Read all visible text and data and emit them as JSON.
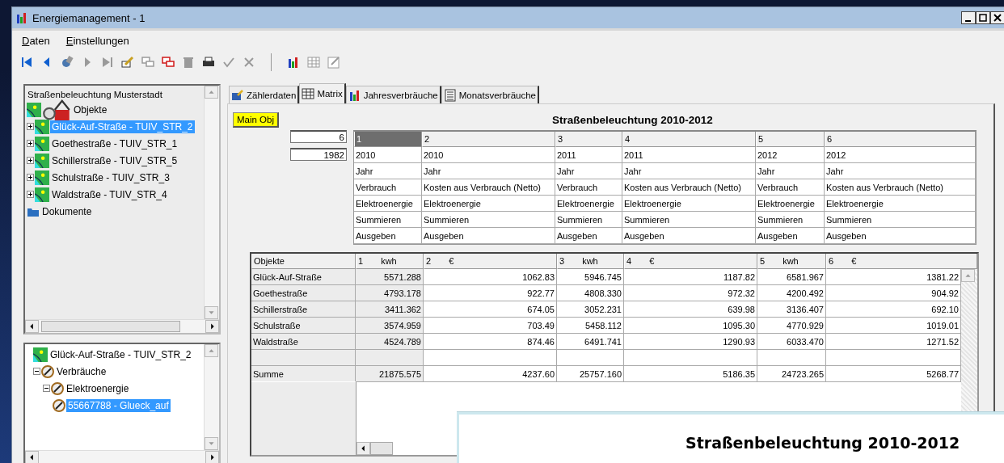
{
  "window": {
    "title": "Energiemanagement - 1"
  },
  "menu": [
    {
      "label": "Daten"
    },
    {
      "label": "Einstellungen"
    }
  ],
  "toolbar": [
    {
      "kind": "first",
      "disabled": false
    },
    {
      "kind": "previous",
      "disabled": false
    },
    {
      "kind": "search",
      "disabled": false
    },
    {
      "kind": "next",
      "disabled": true
    },
    {
      "kind": "last",
      "disabled": true
    },
    {
      "kind": "edit",
      "disabled": false
    },
    {
      "kind": "copy",
      "disabled": true
    },
    {
      "kind": "copy",
      "disabled": false
    },
    {
      "kind": "delete",
      "disabled": true
    },
    {
      "kind": "print",
      "disabled": false
    },
    {
      "kind": "confirm",
      "disabled": true
    },
    {
      "kind": "cancel",
      "disabled": true
    },
    {
      "kind": "separator"
    },
    {
      "kind": "chart",
      "disabled": false
    },
    {
      "kind": "table",
      "disabled": true
    },
    {
      "kind": "form",
      "disabled": true
    }
  ],
  "tree": {
    "title": "Straßenbeleuchtung Musterstadt",
    "items": [
      {
        "label": "Objekte",
        "kind": "objects",
        "selected": false,
        "children": [
          {
            "label": "Glück-Auf-Straße - TUIV_STR_2",
            "kind": "map",
            "expanded": false,
            "selected": true
          },
          {
            "label": "Goethestraße - TUIV_STR_1",
            "kind": "map",
            "expanded": false,
            "selected": false
          },
          {
            "label": "Schillerstraße - TUIV_STR_5",
            "kind": "map",
            "expanded": false,
            "selected": false
          },
          {
            "label": "Schulstraße - TUIV_STR_3",
            "kind": "map",
            "expanded": false,
            "selected": false
          },
          {
            "label": "Waldstraße - TUIV_STR_4",
            "kind": "map",
            "expanded": false,
            "selected": false
          }
        ]
      },
      {
        "label": "Dokumente",
        "kind": "folder",
        "selected": false
      }
    ]
  },
  "detail_tree": {
    "items": [
      {
        "label": "Glück-Auf-Straße - TUIV_STR_2",
        "kind": "map",
        "selected": false
      },
      {
        "label": "Verbräuche",
        "kind": "meter",
        "expanded": true,
        "selected": false,
        "children": [
          {
            "label": "Elektroenergie",
            "kind": "meter",
            "expanded": true,
            "selected": false,
            "children": [
              {
                "label": "55667788 - Glueck_auf",
                "kind": "meter",
                "selected": true
              }
            ]
          }
        ]
      }
    ]
  },
  "tabs": [
    {
      "label": "Zählerdaten",
      "kind": "meter",
      "selected": false
    },
    {
      "label": "Matrix",
      "kind": "table",
      "selected": true
    },
    {
      "label": "Jahresverbräuche",
      "kind": "chart",
      "selected": false
    },
    {
      "label": "Monatsverbräuche",
      "kind": "list",
      "selected": false
    }
  ],
  "matrix": {
    "main_button": "Main Obj",
    "title": "Straßenbeleuchtung 2010-2012",
    "spin_fields": [
      "6",
      "1982"
    ],
    "columns": [
      {
        "label": "1",
        "selected": true
      },
      {
        "label": "2",
        "selected": false
      },
      {
        "label": "3",
        "selected": false
      },
      {
        "label": "4",
        "selected": false
      },
      {
        "label": "5",
        "selected": false
      },
      {
        "label": "6",
        "selected": false
      }
    ],
    "rows": [
      [
        "2010",
        "2010",
        "2011",
        "2011",
        "2012",
        "2012"
      ],
      [
        "Jahr",
        "Jahr",
        "Jahr",
        "Jahr",
        "Jahr",
        "Jahr"
      ],
      [
        "Verbrauch",
        "Kosten aus Verbrauch (Netto)",
        "Verbrauch",
        "Kosten aus Verbrauch (Netto)",
        "Verbrauch",
        "Kosten aus Verbrauch (Netto)"
      ],
      [
        "Elektroenergie",
        "Elektroenergie",
        "Elektroenergie",
        "Elektroenergie",
        "Elektroenergie",
        "Elektroenergie"
      ],
      [
        "Summieren",
        "Summieren",
        "Summieren",
        "Summieren",
        "Summieren",
        "Summieren"
      ],
      [
        "Ausgeben",
        "Ausgeben",
        "Ausgeben",
        "Ausgeben",
        "Ausgeben",
        "Ausgeben"
      ]
    ]
  },
  "result_table": {
    "header": "Objekte",
    "columns": [
      {
        "number": "1",
        "unit": "kwh"
      },
      {
        "number": "2",
        "unit": "€"
      },
      {
        "number": "3",
        "unit": "kwh"
      },
      {
        "number": "4",
        "unit": "€"
      },
      {
        "number": "5",
        "unit": "kwh"
      },
      {
        "number": "6",
        "unit": "€"
      }
    ],
    "rows": [
      {
        "name": "Glück-Auf-Straße",
        "values": [
          "5571.288",
          "1062.83",
          "5946.745",
          "1187.82",
          "6581.967",
          "1381.22"
        ]
      },
      {
        "name": "Goethestraße",
        "values": [
          "4793.178",
          "922.77",
          "4808.330",
          "972.32",
          "4200.492",
          "904.92"
        ]
      },
      {
        "name": "Schillerstraße",
        "values": [
          "3411.362",
          "674.05",
          "3052.231",
          "639.98",
          "3136.407",
          "692.10"
        ]
      },
      {
        "name": "Schulstraße",
        "values": [
          "3574.959",
          "703.49",
          "5458.112",
          "1095.30",
          "4770.929",
          "1019.01"
        ]
      },
      {
        "name": "Waldstraße",
        "values": [
          "4524.789",
          "874.46",
          "6491.741",
          "1290.93",
          "6033.470",
          "1271.52"
        ]
      }
    ],
    "total": {
      "label": "Summe",
      "values": [
        "21875.575",
        "4237.60",
        "25757.160",
        "5186.35",
        "24723.265",
        "5268.77"
      ]
    }
  },
  "overlay_window": {
    "title": "Straßenbeleuchtung 2010-2012"
  }
}
